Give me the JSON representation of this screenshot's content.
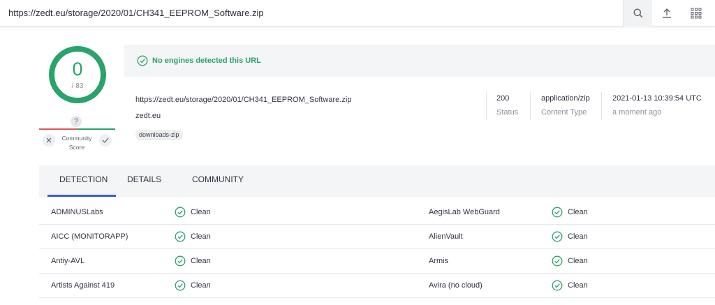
{
  "topbar": {
    "url": "https://zedt.eu/storage/2020/01/CH341_EEPROM_Software.zip",
    "icons": [
      "search-icon",
      "upload-icon",
      "apps-grid-icon"
    ]
  },
  "score": {
    "detections": "0",
    "total": "/ 83",
    "community_label_line1": "Community",
    "community_label_line2": "Score",
    "question_mark": "?"
  },
  "banner": {
    "text": "No engines detected this URL"
  },
  "file": {
    "url": "https://zedt.eu/storage/2020/01/CH341_EEPROM_Software.zip",
    "domain": "zedt.eu",
    "tag": "downloads-zip"
  },
  "meta": {
    "status_value": "200",
    "status_label": "Status",
    "content_type_value": "application/zip",
    "content_type_label": "Content Type",
    "date_value": "2021-01-13 10:39:54 UTC",
    "date_label": "a moment ago"
  },
  "tabs": [
    {
      "label": "DETECTION"
    },
    {
      "label": "DETAILS"
    },
    {
      "label": "COMMUNITY"
    }
  ],
  "detections": [
    {
      "left_engine": "ADMINUSLabs",
      "left_result": "Clean",
      "right_engine": "AegisLab WebGuard",
      "right_result": "Clean"
    },
    {
      "left_engine": "AICC (MONITORAPP)",
      "left_result": "Clean",
      "right_engine": "AlienVault",
      "right_result": "Clean"
    },
    {
      "left_engine": "Antiy-AVL",
      "left_result": "Clean",
      "right_engine": "Armis",
      "right_result": "Clean"
    },
    {
      "left_engine": "Artists Against 419",
      "left_result": "Clean",
      "right_engine": "Avira (no cloud)",
      "right_result": "Clean"
    }
  ],
  "colors": {
    "clean_green": "#29a36a",
    "accent_blue": "#3b60c9",
    "negative_red": "#e0575b"
  }
}
